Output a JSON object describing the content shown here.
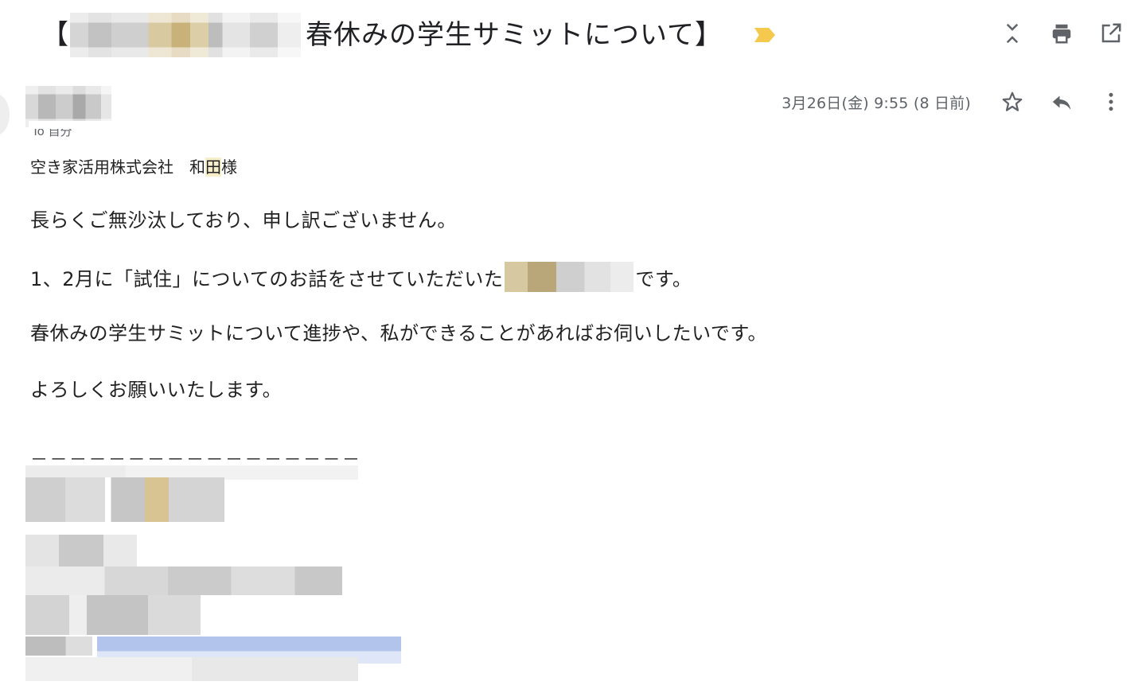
{
  "subject": {
    "open_bracket": "【",
    "text": "春休みの学生サミットについて】",
    "important_marker": "label-important-icon"
  },
  "toolbar": {
    "icons": [
      "expand-collapse-icon",
      "print-icon",
      "open-in-new-window-icon"
    ]
  },
  "message": {
    "date": "3月26日(金) 9:55 (8 日前)",
    "recipient_hint": "To 自分",
    "actions": [
      "star-icon",
      "reply-icon",
      "more-vert-icon"
    ],
    "addressee_company": "空き家活用株式会社",
    "addressee_name_part1": "和",
    "addressee_name_highlight": "田",
    "addressee_name_part2": "様",
    "paragraphs": {
      "p1": "長らくご無沙汰しており、申し訳ございません。",
      "p2_before": "1、2月に「試住」についてのお話をさせていただいた",
      "p2_after": "です。",
      "p3": "春休みの学生サミットについて進捗や、私ができることがあればお伺いしたいです。",
      "p4": "よろしくお願いいたします。"
    },
    "signature_rule": "－－－－－－－－－－－－－－－－－－－"
  },
  "colors": {
    "important_marker": "#f4c94d",
    "date_text": "#5f6368",
    "highlight": "#f7efc9",
    "link_blur": "#b3c4ec"
  }
}
